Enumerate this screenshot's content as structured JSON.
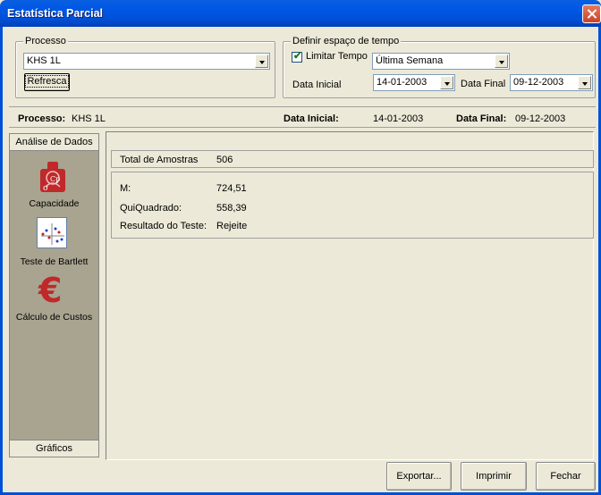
{
  "window": {
    "title": "Estatística Parcial"
  },
  "processo_group": {
    "legend": "Processo",
    "selected": "KHS 1L",
    "refresh_label": "Refresca"
  },
  "time_group": {
    "legend": "Definir espaço de tempo",
    "limit_label": "Limitar Tempo",
    "limit_checked": true,
    "period": "Última Semana",
    "start_label": "Data Inicial",
    "start_value": "14-01-2003",
    "end_label": "Data Final",
    "end_value": "09-12-2003"
  },
  "summary": {
    "process_label": "Processo:",
    "process_value": "KHS 1L",
    "start_label": "Data Inicial:",
    "start_value": "14-01-2003",
    "end_label": "Data Final:",
    "end_value": "09-12-2003"
  },
  "sidebar": {
    "header": "Análise de Dados",
    "items": [
      {
        "label": "Capacidade",
        "icon": "capacity-icon"
      },
      {
        "label": "Teste de Bartlett",
        "icon": "scatter-plot-icon"
      },
      {
        "label": "Cálculo de Custos",
        "icon": "euro-icon"
      }
    ],
    "footer": "Gráficos"
  },
  "results": {
    "total_label": "Total de Amostras",
    "total_value": "506",
    "m_label": "M:",
    "m_value": "724,51",
    "chi_label": "QuiQuadrado:",
    "chi_value": "558,39",
    "result_label": "Resultado do Teste:",
    "result_value": "Rejeite"
  },
  "buttons": {
    "export": "Exportar...",
    "print": "Imprimir",
    "close": "Fechar"
  },
  "colors": {
    "titlebar": "#0054E3",
    "accent_red": "#C0282A"
  }
}
